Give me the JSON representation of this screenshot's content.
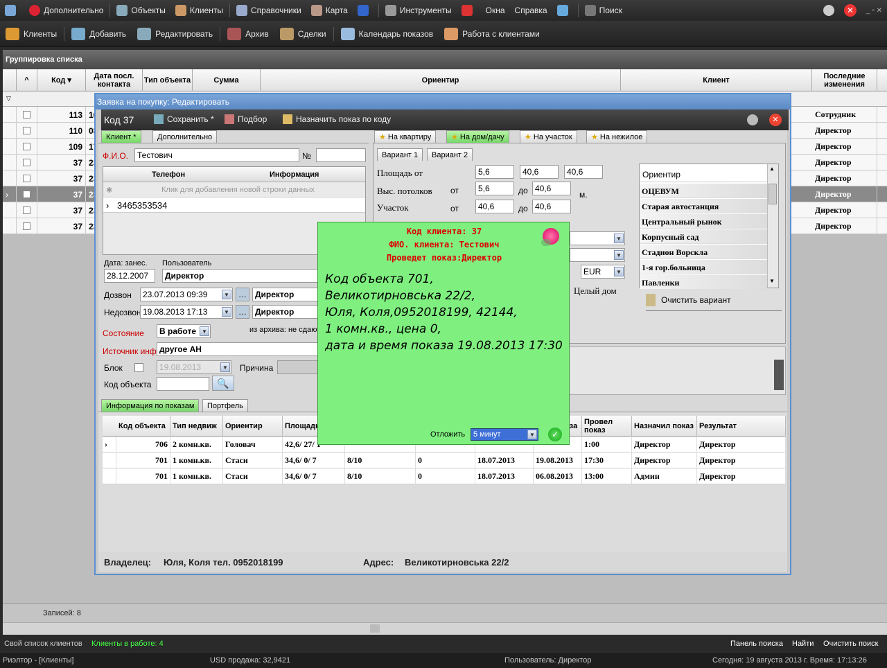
{
  "menubar": {
    "items": [
      "Дополнительно",
      "Объекты",
      "Клиенты",
      "Справочники",
      "Карта",
      "Инструменты",
      "Окна",
      "Справка",
      "Поиск"
    ]
  },
  "toolbar": {
    "items": [
      "Клиенты",
      "Добавить",
      "Редактировать",
      "Архив",
      "Сделки",
      "Календарь показов",
      "Работа с клиентами"
    ]
  },
  "grouping": "Группировка списка",
  "grid": {
    "headers": [
      "Код",
      "Дата посл. контакта",
      "Тип объекта",
      "Сумма",
      "Ориентир",
      "Клиент",
      "Последние изменения"
    ],
    "rows": [
      {
        "code": "113",
        "d": "16",
        "last": "Сотрудник"
      },
      {
        "code": "110",
        "d": "08",
        "last": "Директор"
      },
      {
        "code": "109",
        "d": "17",
        "last": "Директор"
      },
      {
        "code": "37",
        "d": "23",
        "last": "Директор"
      },
      {
        "code": "37",
        "d": "23",
        "last": "Директор"
      },
      {
        "code": "37",
        "d": "23",
        "last": "Директор"
      },
      {
        "code": "37",
        "d": "23",
        "last": "Директор"
      },
      {
        "code": "37",
        "d": "23",
        "last": "Директор"
      }
    ],
    "records": "Записей: 8"
  },
  "status": {
    "own_list": "Свой список клиентов",
    "in_work": "Клиенты в работе: 4",
    "search_panel": "Панель поиска",
    "find": "Найти",
    "clear": "Очистить поиск",
    "app": "Риэлтор - [Клиенты]",
    "usd": "USD продажа: 32,9421",
    "user": "Пользователь: Директор",
    "date": "Сегодня: 19 августа 2013 г. Время: 17:13:26"
  },
  "dialog": {
    "title": "Заявка на покупку: Редактировать",
    "code": "Код 37",
    "save": "Сохранить *",
    "pick": "Подбор",
    "assign": "Назначить показ по коду",
    "tabs_left": [
      "Клиент *",
      "Дополнительно"
    ],
    "tabs_right": [
      "На квартиру",
      "На дом/дачу",
      "На участок",
      "На нежилое"
    ],
    "variants": [
      "Вариант 1",
      "Вариант 2"
    ],
    "fio_label": "Ф.И.О.",
    "fio": "Тестович",
    "no_label": "№",
    "phone_cols": [
      "Телефон",
      "Информация"
    ],
    "phone_hint": "Клик для добавления новой строки данных",
    "phone": "3465353534",
    "date_label": "Дата: занес.",
    "date": "28.12.2007",
    "user_label": "Пользователь",
    "user": "Директор",
    "dozvon_label": "Дозвон",
    "dozvon": "23.07.2013 09:39",
    "dozvon_user": "Директор",
    "nedozvon_label": "Недозвон",
    "nedozvon": "19.08.2013 17:13",
    "nedozvon_user": "Директор",
    "state_label": "Состояние",
    "state": "В работе",
    "archive_label": "из архива: не сдают",
    "source_label": "Источник инф.",
    "source": "другое АН",
    "block_label": "Блок",
    "block_date": "19.08.2013",
    "reason_label": "Причина",
    "objcode_label": "Код объекта",
    "area_label": "Площадь от",
    "area": [
      "5,6",
      "40,6",
      "40,6"
    ],
    "ceil_label": "Выс. потолков",
    "ceil_from": "от",
    "ceil": [
      "5,6",
      "40,6"
    ],
    "ceil_to": "до",
    "ceil_unit": "м.",
    "plot_label": "Участок",
    "plot_from": "от",
    "plot": [
      "40,6",
      "40,6"
    ],
    "plot_to": "до",
    "currency": "EUR",
    "whole_house": "Целый дом",
    "clear_variant": "Очистить вариант",
    "landmarks_header": "Ориентир",
    "landmarks": [
      "ОЦЕВУМ",
      "Старая автостанция",
      "Центральный рынок",
      "Корпусный сад",
      "Стадион Ворскла",
      "1-я гор.больница",
      "Павленки"
    ],
    "bottom_tabs": [
      "Информация по показам",
      "Портфель"
    ],
    "shows_headers": [
      "Код объекта",
      "Тип недвиж",
      "Ориентир",
      "Площадь",
      "",
      "",
      "",
      "ремя оказа",
      "Провел показ",
      "Назначил показ",
      "Результат"
    ],
    "shows": [
      {
        "code": "706",
        "type": "2 комн.кв.",
        "orient": "Головач",
        "area": "42,6/ 27/ 1",
        "floor": "",
        "x": "",
        "d1": "",
        "d2": "",
        "time": "1:00",
        "by": "Директор",
        "assigned": "Директор"
      },
      {
        "code": "701",
        "type": "1 комн.кв.",
        "orient": "Стаси",
        "area": "34,6/ 0/ 7",
        "floor": "8/10",
        "x": "0",
        "d1": "18.07.2013",
        "d2": "19.08.2013",
        "time": "17:30",
        "by": "Директор",
        "assigned": "Директор"
      },
      {
        "code": "701",
        "type": "1 комн.кв.",
        "orient": "Стаси",
        "area": "34,6/ 0/ 7",
        "floor": "8/10",
        "x": "0",
        "d1": "18.07.2013",
        "d2": "06.08.2013",
        "time": "13:00",
        "by": "Админ",
        "assigned": "Директор"
      }
    ],
    "owner_label": "Владелец:",
    "owner": "Юля, Коля тел. 0952018199",
    "address_label": "Адрес:",
    "address": "Великотирновська 22/2"
  },
  "note": {
    "l1": "Код клиента: 37",
    "l2": "ФИО. клиента: Тестович",
    "l3": "Проведет показ:Директор",
    "b1": "Код объекта 701,",
    "b2": "Великотирновська 22/2,",
    "b3": "Юля, Коля,0952018199, 42144,",
    "b4": "1 комн.кв., цена 0,",
    "b5": "дата и время показа 19.08.2013 17:30",
    "postpone_label": "Отложить",
    "postpone": "5 минут"
  }
}
